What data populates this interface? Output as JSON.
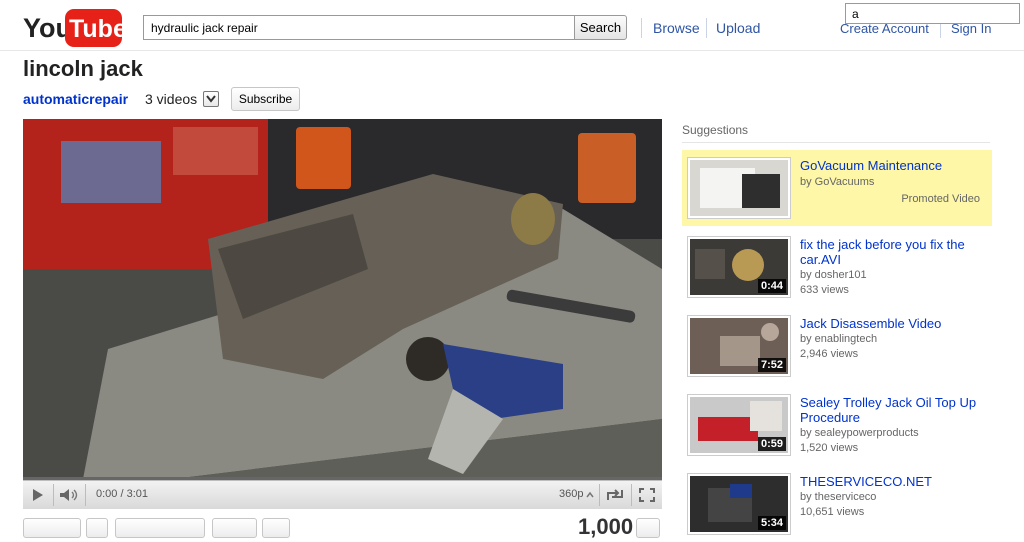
{
  "header": {
    "logo_text": {
      "you": "You",
      "tube": "Tube"
    },
    "search": {
      "value": "hydraulic jack repair",
      "button": "Search"
    },
    "nav": {
      "browse": "Browse",
      "upload": "Upload"
    },
    "account": {
      "create": "Create Account",
      "signin": "Sign In"
    },
    "overlay_input": "a"
  },
  "video": {
    "title": "lincoln jack",
    "channel": "automaticrepair",
    "videos_count": "3 videos",
    "subscribe": "Subscribe",
    "time": "0:00 / 3:01",
    "quality": "360p",
    "progress": 0,
    "view_count": "1,000"
  },
  "sidebar": {
    "label": "Suggestions",
    "items": [
      {
        "title": "GoVacuum Maintenance",
        "by": "by GoVacuums",
        "promo": "Promoted Video"
      },
      {
        "title": "fix the jack before you fix the car.AVI",
        "by": "by dosher101",
        "views": "633 views",
        "duration": "0:44"
      },
      {
        "title": "Jack Disassemble Video",
        "by": "by enablingtech",
        "views": "2,946 views",
        "duration": "7:52"
      },
      {
        "title": "Sealey Trolley Jack Oil Top Up Procedure",
        "by": "by sealeypowerproducts",
        "views": "1,520 views",
        "duration": "0:59"
      },
      {
        "title": "THESERVICECO.NET",
        "by": "by theserviceco",
        "views": "10,651 views",
        "duration": "5:34"
      }
    ]
  },
  "colors": {
    "link": "#0033cc",
    "promoted_bg": "#fdf7a7",
    "logo_red": "#e62117",
    "progress": "#cc181e"
  }
}
